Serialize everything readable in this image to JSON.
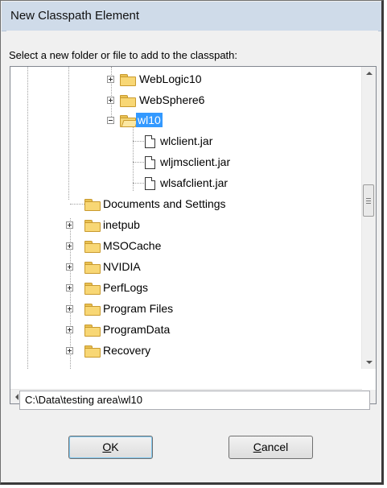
{
  "window": {
    "title": "New Classpath Element"
  },
  "prompt": "Select a new folder or file to add to the classpath:",
  "tree": {
    "items": [
      {
        "label": "WebLogic10",
        "expander": "plus",
        "icon": "folder-icon"
      },
      {
        "label": "WebSphere6",
        "expander": "plus",
        "icon": "folder-icon"
      },
      {
        "label": "wl10",
        "expander": "minus",
        "icon": "open-folder-icon",
        "selected": true
      },
      {
        "label": "wlclient.jar",
        "icon": "file-icon"
      },
      {
        "label": "wljmsclient.jar",
        "icon": "file-icon"
      },
      {
        "label": "wlsafclient.jar",
        "icon": "file-icon"
      },
      {
        "label": "Documents and Settings",
        "icon": "folder-icon"
      },
      {
        "label": "inetpub",
        "expander": "plus",
        "icon": "folder-icon"
      },
      {
        "label": "MSOCache",
        "expander": "plus",
        "icon": "folder-icon"
      },
      {
        "label": "NVIDIA",
        "expander": "plus",
        "icon": "folder-icon"
      },
      {
        "label": "PerfLogs",
        "expander": "plus",
        "icon": "folder-icon"
      },
      {
        "label": "Program Files",
        "expander": "plus",
        "icon": "folder-icon"
      },
      {
        "label": "ProgramData",
        "expander": "plus",
        "icon": "folder-icon"
      },
      {
        "label": "Recovery",
        "expander": "plus",
        "icon": "folder-icon"
      }
    ]
  },
  "path_value": "C:\\Data\\testing area\\wl10",
  "buttons": {
    "ok": {
      "mnemonic": "O",
      "rest": "K"
    },
    "cancel": {
      "mnemonic": "C",
      "rest": "ancel"
    }
  },
  "colors": {
    "selection": "#3399ff",
    "titlebar": "#cfdbe9",
    "folder": "#f8d775"
  }
}
